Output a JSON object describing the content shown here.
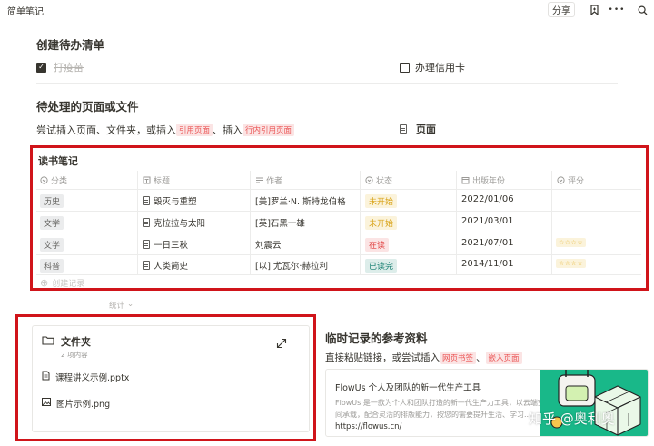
{
  "topbar": {
    "title": "简单笔记",
    "share_label": "分享",
    "icons": [
      "bookmark-icon",
      "more-icon",
      "search-icon"
    ],
    "more_glyph": "•••"
  },
  "todo": {
    "heading": "创建待办清单",
    "items": [
      {
        "text": "打疫苗",
        "checked": true
      },
      {
        "text": "办理信用卡",
        "checked": false
      }
    ]
  },
  "pending": {
    "heading": "待处理的页面或文件",
    "text_part1": "尝试插入页面、文件夹，或插入",
    "tag1": "引用页面",
    "text_part2": "、插入",
    "tag2": "行内引用页面",
    "page_label": "页面"
  },
  "reading": {
    "title": "读书笔记",
    "columns": [
      "分类",
      "标题",
      "作者",
      "状态",
      "出版年份",
      "评分"
    ],
    "rows": [
      {
        "category": "历史",
        "title": "毁灭与重塑",
        "author": "[美]罗兰·N. 斯特龙伯格",
        "status": "未开始",
        "status_color": "yellow",
        "year": "2022/01/06",
        "rating": ""
      },
      {
        "category": "文学",
        "title": "克拉拉与太阳",
        "author": "[英]石黑一雄",
        "status": "未开始",
        "status_color": "yellow",
        "year": "2021/03/01",
        "rating": ""
      },
      {
        "category": "文学",
        "title": "一日三秋",
        "author": "刘震云",
        "status": "在读",
        "status_color": "red",
        "year": "2021/07/01",
        "rating": "☆☆☆☆"
      },
      {
        "category": "科普",
        "title": "人类简史",
        "author": "[以] 尤瓦尔·赫拉利",
        "status": "已读完",
        "status_color": "green",
        "year": "2014/11/01",
        "rating": "☆☆☆☆"
      }
    ],
    "create_label": "创建记录",
    "stats_label": "统计"
  },
  "folder": {
    "name": "文件夹",
    "count": "2 项内容",
    "files": [
      {
        "name": "课程讲义示例.pptx",
        "icon": "document-icon"
      },
      {
        "name": "图片示例.png",
        "icon": "image-icon"
      }
    ]
  },
  "temp": {
    "heading": "临时记录的参考资料",
    "text_part1": "直接粘贴链接，或尝试插入",
    "tag1": "网页书签",
    "text_part2": "、",
    "tag2": "嵌入页面"
  },
  "bookmark": {
    "title": "FlowUs 个人及团队的新一代生产工具",
    "desc_line1": "FlowUs 是一款为个人和团队打造的新一代生产力工具，以云端空",
    "desc_line2": "间承载，配合灵活的排版能力，按您的需要提升生活、学习...",
    "url": "https://flowus.cn/"
  },
  "watermark": "知乎 @奥利奥",
  "colors": {
    "highlight_border": "#d0141a",
    "tag_red": "#eb5757"
  }
}
